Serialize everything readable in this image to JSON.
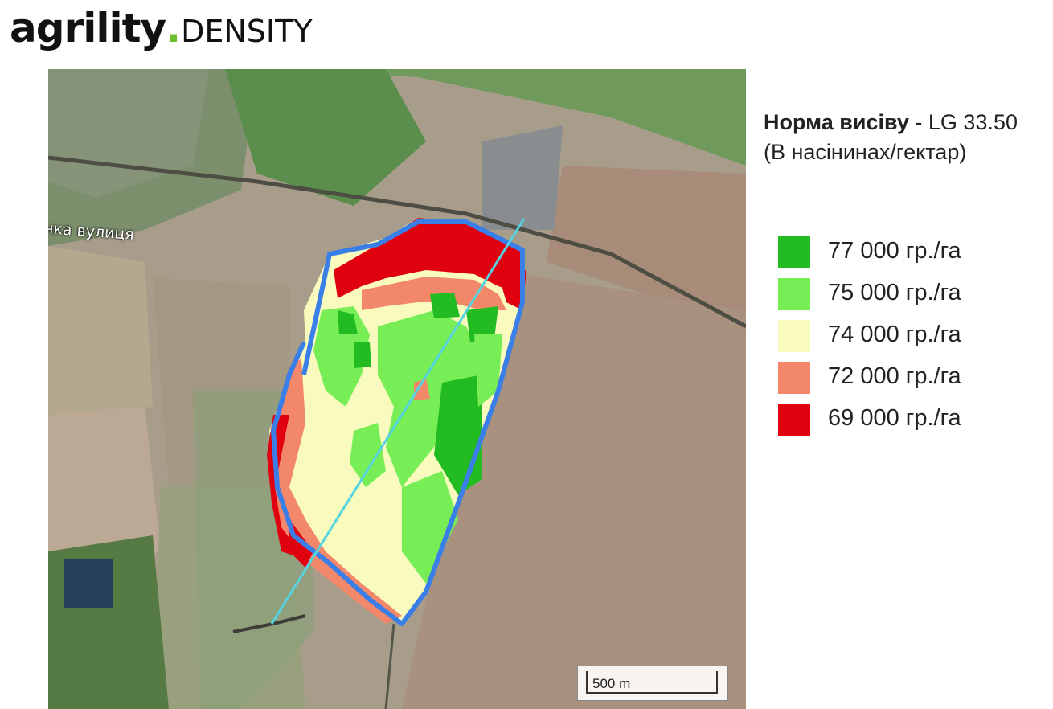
{
  "logo": {
    "word": "agrility",
    "dot": ".",
    "sub": "DENSITY"
  },
  "map": {
    "street_label": "нка вулиця",
    "scale_label": "500 m"
  },
  "legend": {
    "title_bold": "Норма висіву",
    "title_rest": " - LG 33.50",
    "units": "(В насінинах/гектар)",
    "items": [
      {
        "label": "77 000 гр./га",
        "color": "#22bb22"
      },
      {
        "label": "75 000 гр./га",
        "color": "#77ee55"
      },
      {
        "label": "74 000 гр./га",
        "color": "#f8fbbd"
      },
      {
        "label": "72 000 гр./га",
        "color": "#f3876a"
      },
      {
        "label": "69 000 гр./га",
        "color": "#e00010"
      }
    ]
  },
  "colors": {
    "boundary": "#3a7fe8",
    "transect": "#56d3e0"
  }
}
